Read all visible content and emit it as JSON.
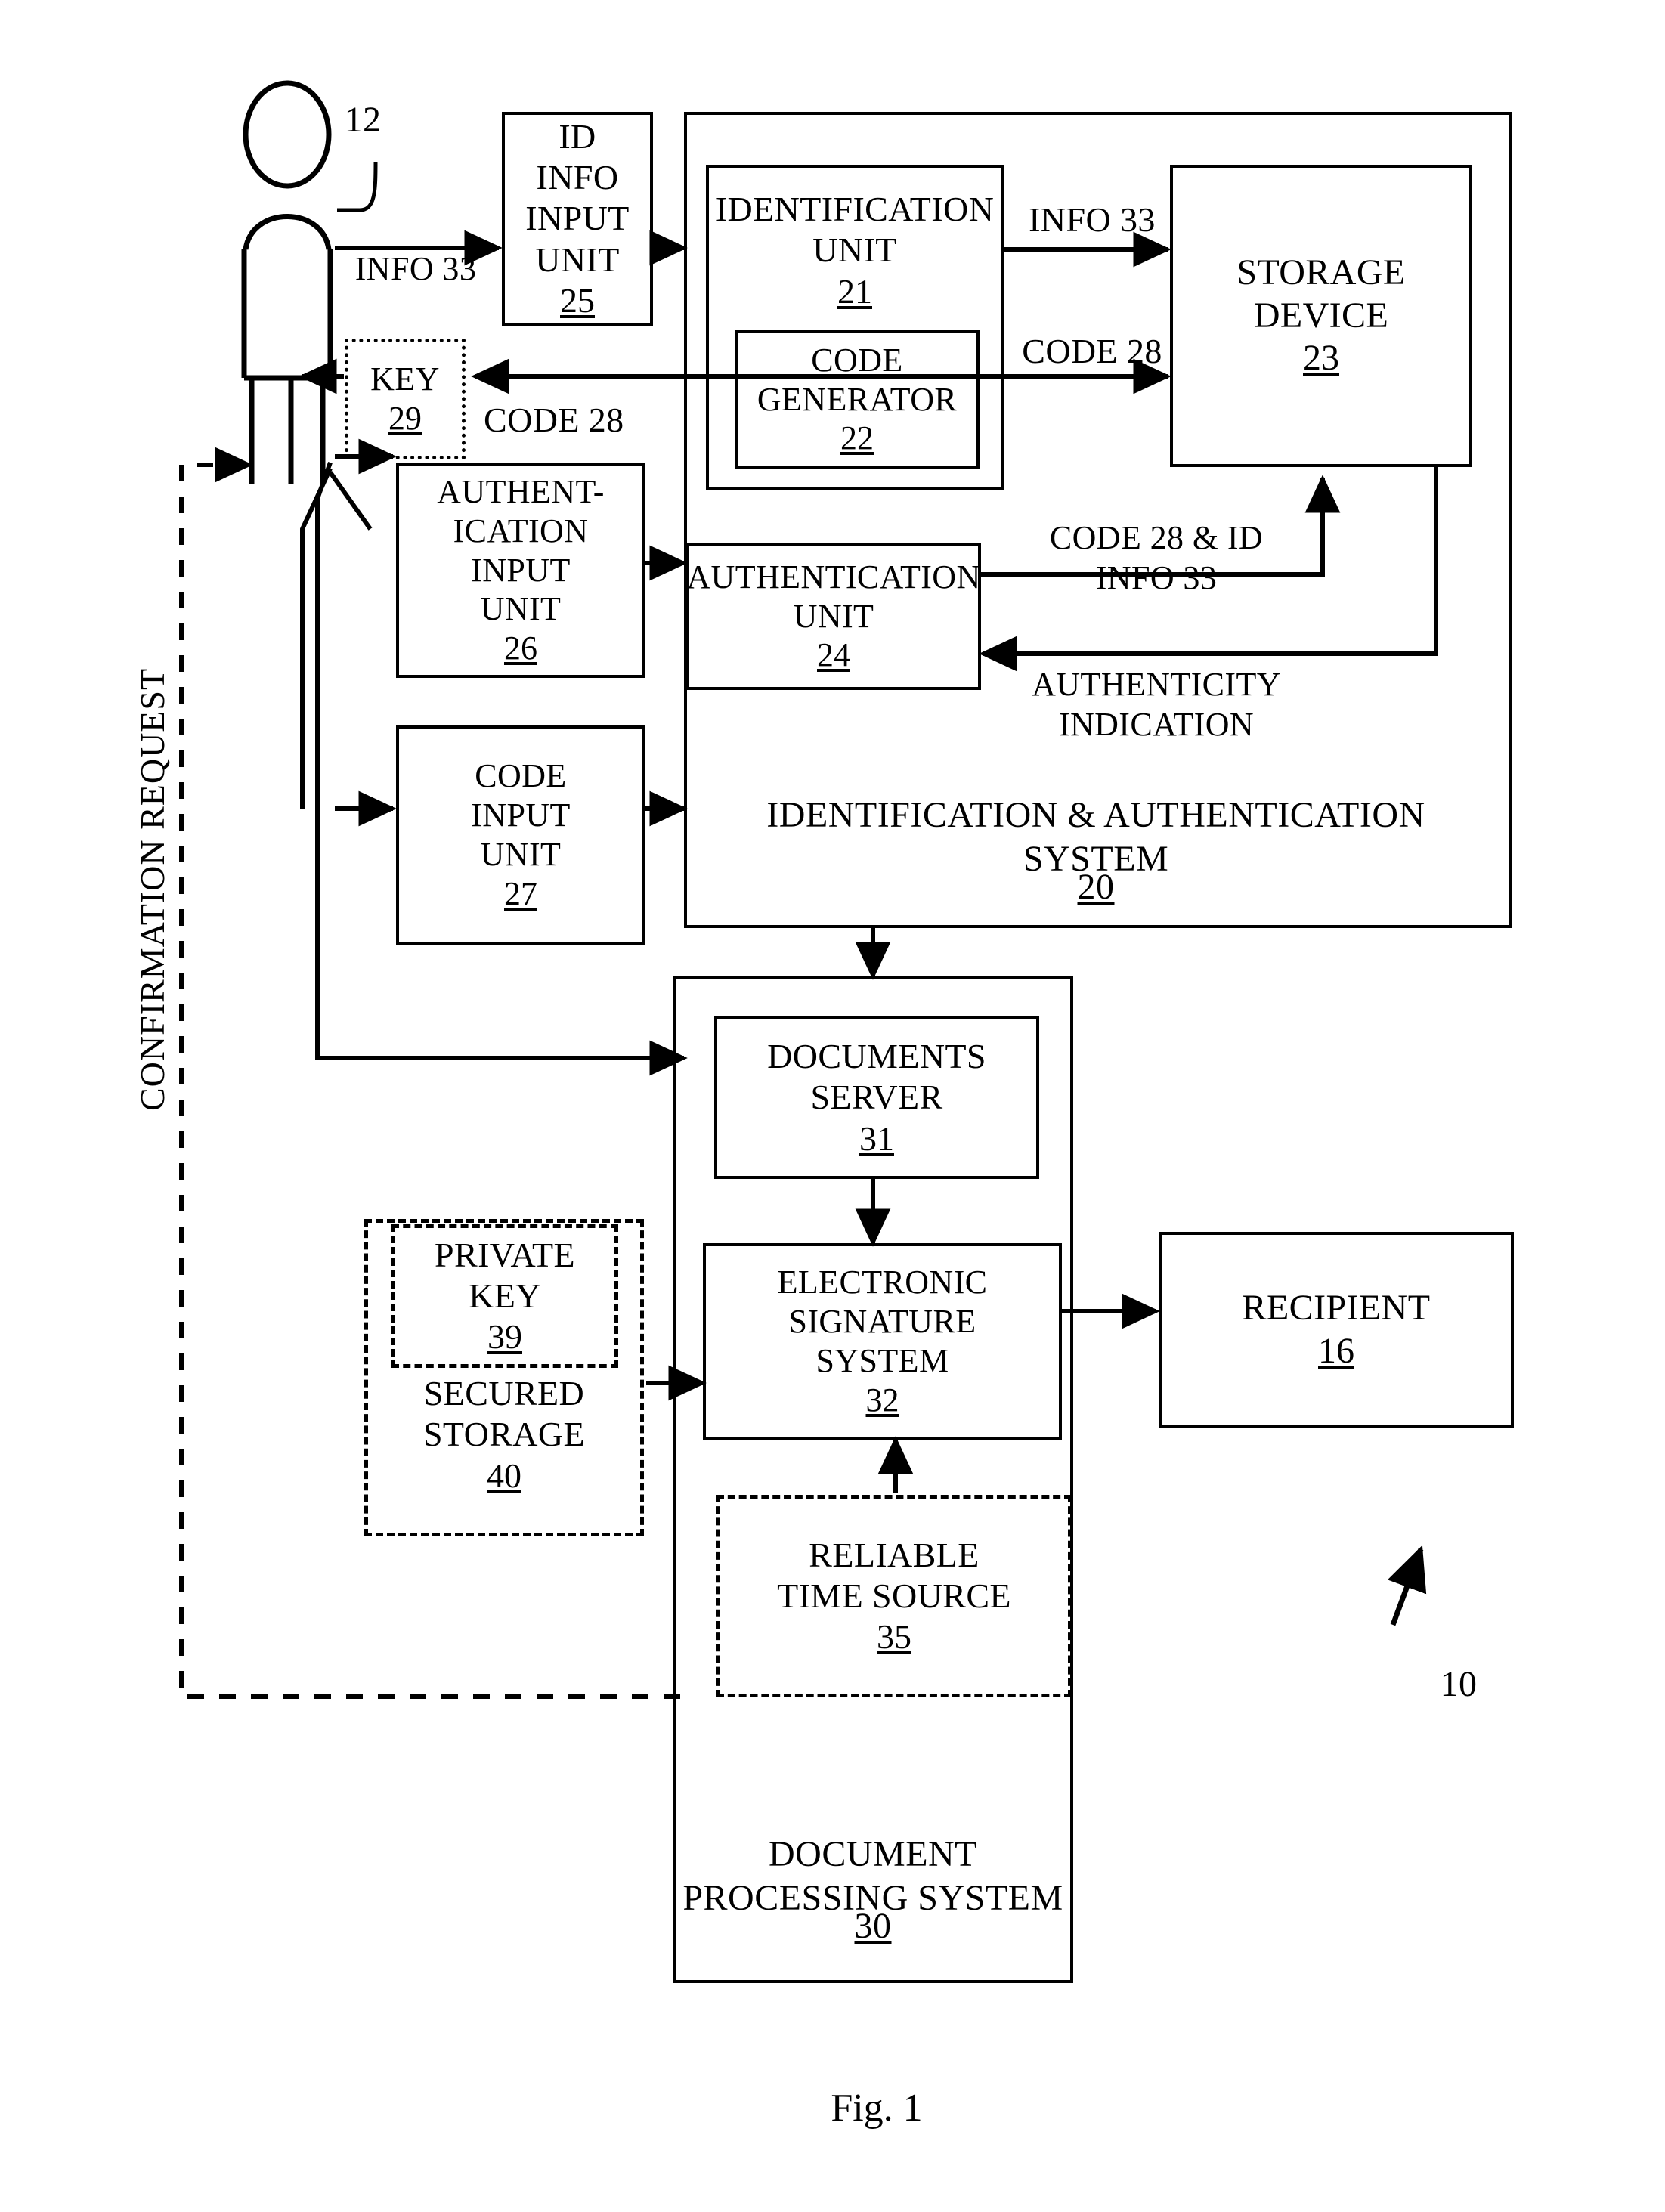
{
  "figure": {
    "caption": "Fig. 1",
    "system_ref": "10",
    "user_ref": "12"
  },
  "actors": {
    "user_icon": "person-stick-figure"
  },
  "boxes": {
    "id_info_input_unit": {
      "label": "ID\nINFO\nINPUT\nUNIT",
      "ref": "25"
    },
    "identification_unit": {
      "label": "IDENTIFICATION\nUNIT",
      "ref": "21"
    },
    "code_generator": {
      "label": "CODE\nGENERATOR",
      "ref": "22"
    },
    "storage_device": {
      "label": "STORAGE\nDEVICE",
      "ref": "23"
    },
    "key": {
      "label": "KEY",
      "ref": "29"
    },
    "authentication_input_unit": {
      "label": "AUTHENT-\nICATION\nINPUT\nUNIT",
      "ref": "26"
    },
    "authentication_unit": {
      "label": "AUTHENTICATION\nUNIT",
      "ref": "24"
    },
    "code_input_unit": {
      "label": "CODE\nINPUT\nUNIT",
      "ref": "27"
    },
    "documents_server": {
      "label": "DOCUMENTS\nSERVER",
      "ref": "31"
    },
    "electronic_signature_system": {
      "label": "ELECTRONIC\nSIGNATURE\nSYSTEM",
      "ref": "32"
    },
    "private_key": {
      "label": "PRIVATE\nKEY",
      "ref": "39"
    },
    "secured_storage": {
      "label": "SECURED\nSTORAGE",
      "ref": "40"
    },
    "reliable_time_source": {
      "label": "RELIABLE\nTIME SOURCE",
      "ref": "35"
    },
    "recipient": {
      "label": "RECIPIENT",
      "ref": "16"
    }
  },
  "systems": {
    "identification_authentication_system": {
      "label": "IDENTIFICATION & AUTHENTICATION\nSYSTEM",
      "ref": "20"
    },
    "document_processing_system": {
      "label": "DOCUMENT\nPROCESSING SYSTEM",
      "ref": "30"
    }
  },
  "edge_labels": {
    "user_to_id_input": "INFO 33",
    "id_unit_to_storage": "INFO 33",
    "code_gen_to_storage": "CODE 28",
    "code_to_key": "CODE 28",
    "auth_to_storage": "CODE 28 & ID\nINFO 33",
    "storage_to_auth": "AUTHENTICITY\nINDICATION",
    "confirmation_request": "CONFIRMATION REQUEST"
  }
}
